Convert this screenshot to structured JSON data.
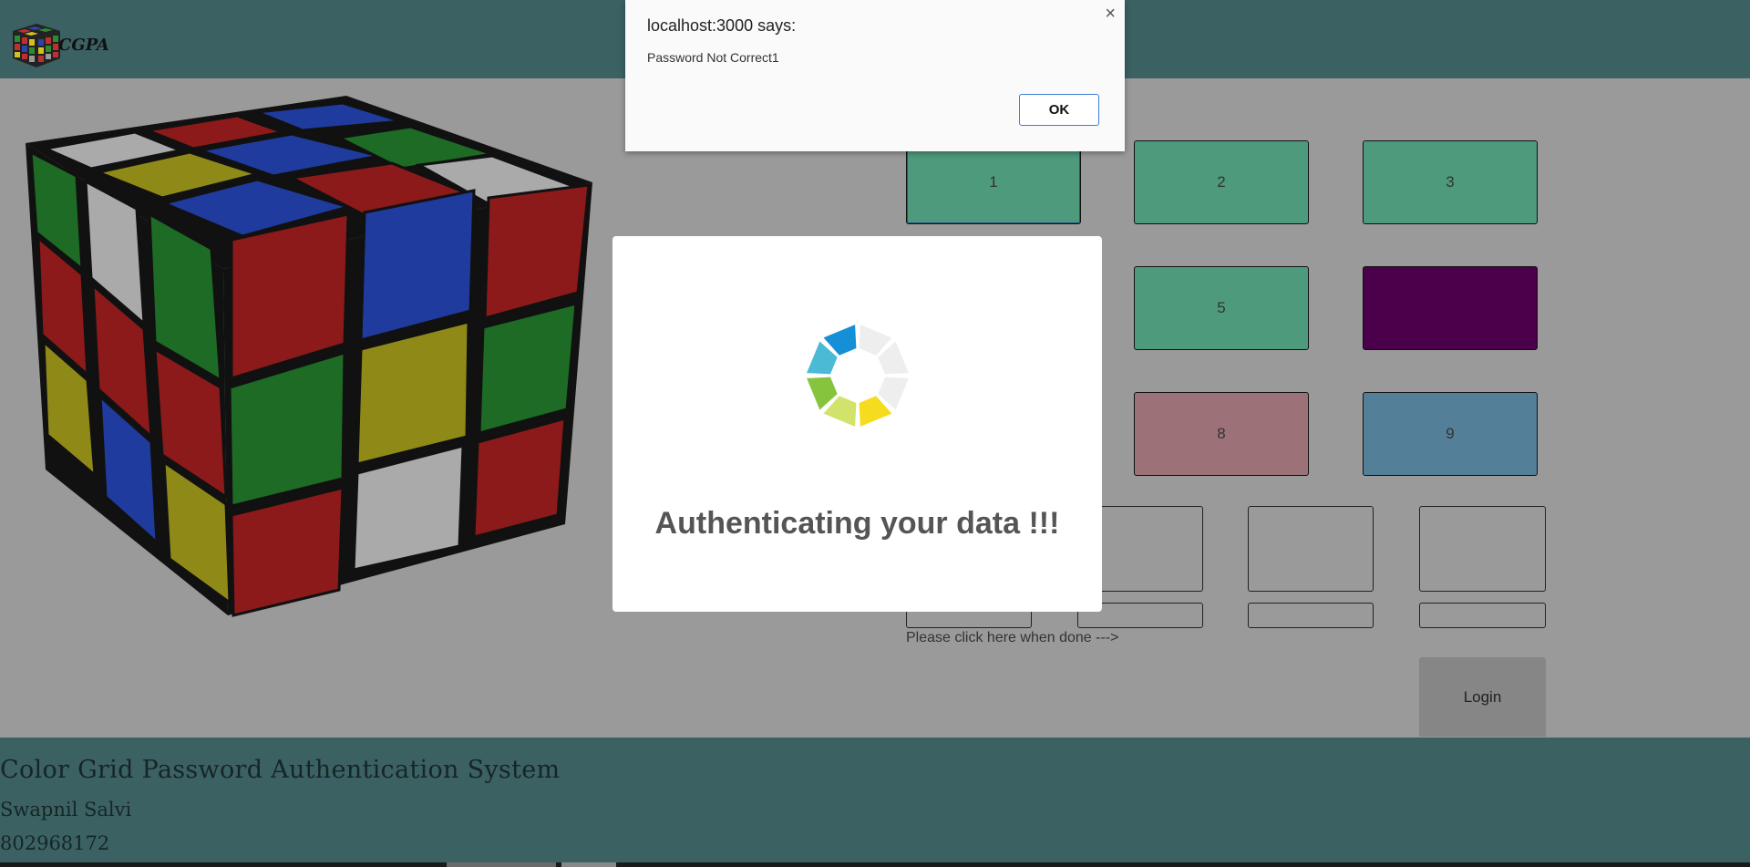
{
  "header": {
    "logo_text": "CGPA"
  },
  "grid": [
    {
      "label": "1",
      "color": "#4e9a7c"
    },
    {
      "label": "2",
      "color": "#4e9a7c"
    },
    {
      "label": "3",
      "color": "#4e9a7c"
    },
    {
      "label": "5",
      "color": "#4e9a7c"
    },
    {
      "label": "",
      "color": "#4b004b"
    },
    {
      "label": "8",
      "color": "#9c7177"
    },
    {
      "label": "9",
      "color": "#537f99"
    }
  ],
  "done_text": "Please click here when done --->",
  "login_label": "Login",
  "footer": {
    "title": "Color Grid Password Authentication System",
    "name": "Swapnil Salvi",
    "id": "802968172"
  },
  "modal": {
    "message": "Authenticating your data !!!"
  },
  "alert": {
    "title": "localhost:3000 says:",
    "message": "Password Not Correct1",
    "ok_label": "OK",
    "close_glyph": "×"
  }
}
